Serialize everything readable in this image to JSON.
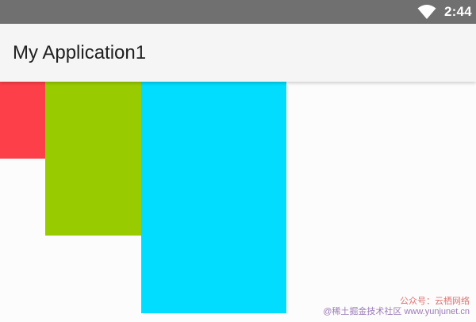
{
  "status_bar": {
    "time": "2:44",
    "background": "#707070",
    "icons": [
      "wifi-icon"
    ]
  },
  "app_bar": {
    "title": "My Application1",
    "background": "#f5f5f5"
  },
  "content": {
    "boxes": [
      {
        "name": "red-box",
        "color": "#fd3f49"
      },
      {
        "name": "green-box",
        "color": "#99cc00"
      },
      {
        "name": "cyan-box",
        "color": "#00ddff"
      }
    ]
  },
  "watermark": {
    "line1": "公众号：云栖网络",
    "line2": "@稀土掘金技术社区 www.yunjunet.cn"
  }
}
